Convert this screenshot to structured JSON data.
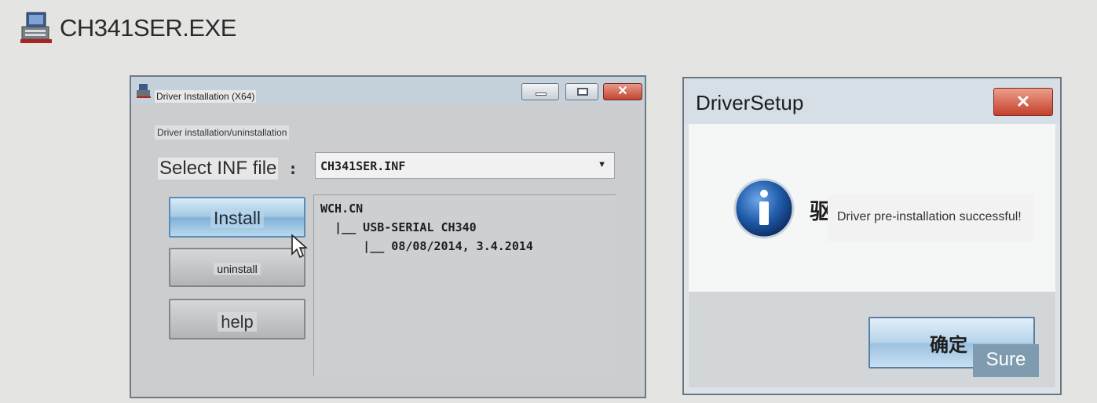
{
  "app": {
    "title": "CH341SER.EXE"
  },
  "driver_window": {
    "title": "Driver Installation (X64)",
    "group_label": "Driver installation/uninstallation",
    "inf_label": "Select INF file",
    "inf_colon": ":",
    "inf_selected": "CH341SER.INF",
    "buttons": {
      "install": "Install",
      "uninstall": "uninstall",
      "help": "help"
    },
    "info_lines": [
      "WCH.CN",
      "  |__ USB-SERIAL CH340",
      "      |__ 08/08/2014, 3.4.2014"
    ]
  },
  "setup_dialog": {
    "title": "DriverSetup",
    "leading_char": "驱",
    "message": "Driver pre-installation successful!",
    "ok_label": "确定",
    "ok_overlay": "Sure"
  },
  "colors": {
    "background": "#e4e5e3",
    "install_button": "#a2c9e4",
    "close_button": "#c2442f",
    "info_icon": "#1f5aa8"
  },
  "icons": [
    "app-window-icon",
    "driver-window-icon",
    "minimize-icon",
    "maximize-icon",
    "close-icon",
    "info-icon",
    "mouse-cursor-icon"
  ]
}
